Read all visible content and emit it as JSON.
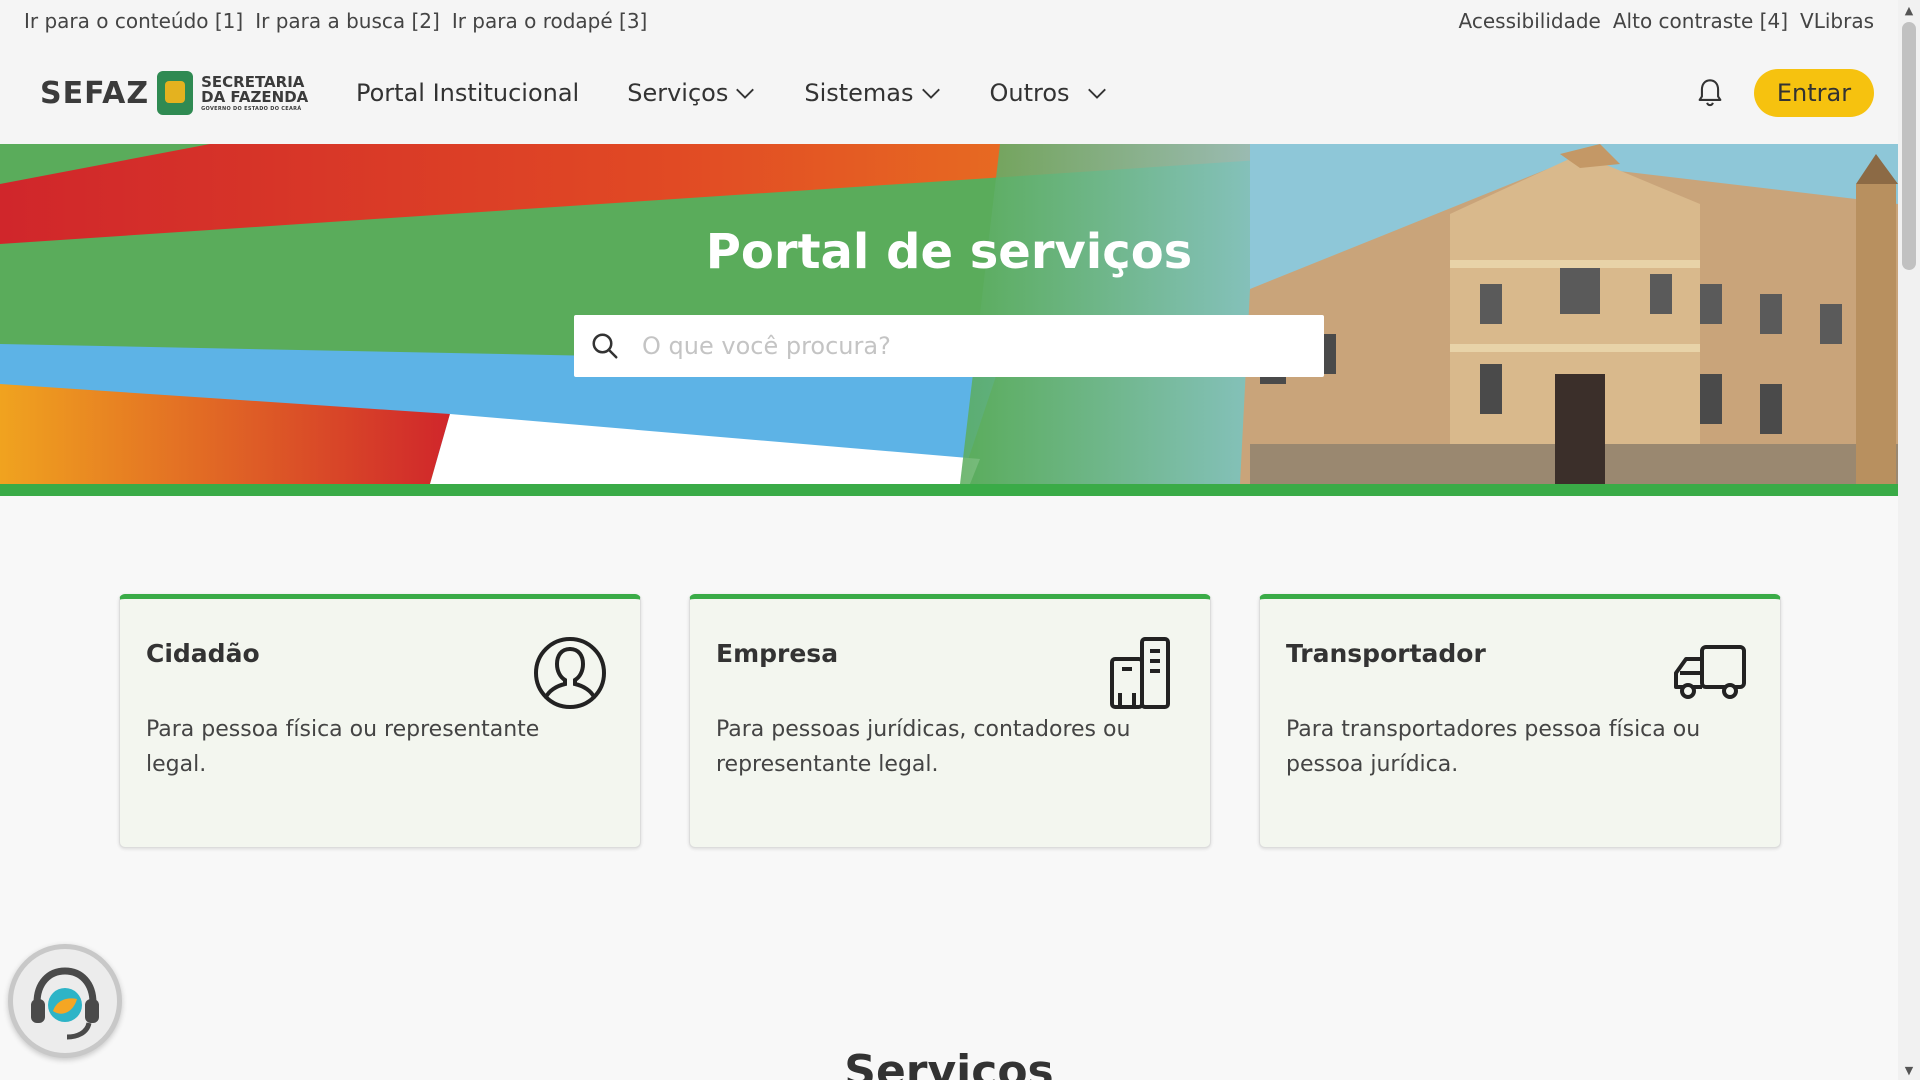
{
  "skip_links": {
    "content": "Ir para o conteúdo [1]",
    "search": "Ir para a busca [2]",
    "footer": "Ir para o rodapé [3]"
  },
  "accessibility": {
    "access": "Acessibilidade",
    "contrast": "Alto contraste [4]",
    "vlibras": "VLibras"
  },
  "logo": {
    "sefaz": "SEFAZ",
    "line1": "SECRETARIA",
    "line2": "DA FAZENDA",
    "line3": "GOVERNO DO ESTADO DO CEARÁ"
  },
  "nav": {
    "portal": "Portal Institucional",
    "servicos": "Serviços",
    "sistemas": "Sistemas",
    "outros": "Outros"
  },
  "header": {
    "login_label": "Entrar"
  },
  "hero": {
    "title": "Portal de serviços",
    "search_placeholder": "O que você procura?"
  },
  "cards": [
    {
      "title": "Cidadão",
      "description": "Para pessoa física ou representante legal.",
      "icon": "user-circle-icon"
    },
    {
      "title": "Empresa",
      "description": "Para pessoas jurídicas, contadores ou representante legal.",
      "icon": "buildings-icon"
    },
    {
      "title": "Transportador",
      "description": "Para transportadores pessoa física ou pessoa jurídica.",
      "icon": "truck-icon"
    }
  ],
  "services_heading": "Serviços",
  "colors": {
    "accent_green": "#3aab47",
    "button_yellow": "#f6c20f",
    "card_bg": "#f3f6ef"
  }
}
